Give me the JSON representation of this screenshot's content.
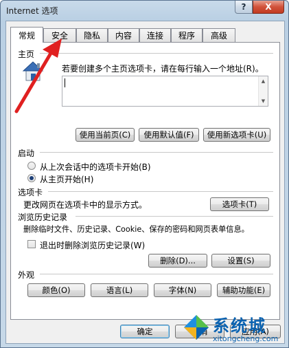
{
  "window": {
    "title": "Internet 选项",
    "help_label": "?",
    "close_label": "X"
  },
  "tabs": [
    {
      "label": "常规",
      "active": true
    },
    {
      "label": "安全",
      "active": false
    },
    {
      "label": "隐私",
      "active": false
    },
    {
      "label": "内容",
      "active": false
    },
    {
      "label": "连接",
      "active": false
    },
    {
      "label": "程序",
      "active": false
    },
    {
      "label": "高级",
      "active": false
    }
  ],
  "home": {
    "section_label": "主页",
    "description": "若要创建多个主页选项卡，请在每行输入一个地址(R)。",
    "value": "",
    "buttons": {
      "use_current": "使用当前页(C)",
      "use_default": "使用默认值(F)",
      "use_new_tab": "使用新选项卡(U)"
    }
  },
  "startup": {
    "section_label": "启动",
    "option_last_session": "从上次会话中的选项卡开始(B)",
    "option_home_page": "从主页开始(H)",
    "selected": "option_home_page"
  },
  "tabs_section": {
    "section_label": "选项卡",
    "description": "更改网页在选项卡中的显示方式。",
    "button": "选项卡(T)"
  },
  "history": {
    "section_label": "浏览历史记录",
    "description": "删除临时文件、历史记录、Cookie、保存的密码和网页表单信息。",
    "checkbox_label": "退出时删除浏览历史记录(W)",
    "checked": false,
    "delete_button": "删除(D)...",
    "settings_button": "设置(S)"
  },
  "appearance": {
    "section_label": "外观",
    "colors_button": "颜色(O)",
    "languages_button": "语言(L)",
    "fonts_button": "字体(N)",
    "accessibility_button": "辅助功能(E)"
  },
  "footer": {
    "ok_button": "确定",
    "cancel_button": "取消",
    "apply_button": "应用(A)"
  },
  "watermark": {
    "brand": "系统城",
    "domain": "xitongcheng.com"
  },
  "colors": {
    "annotation_arrow": "#e02020",
    "watermark_blue": "#0a62b0"
  }
}
